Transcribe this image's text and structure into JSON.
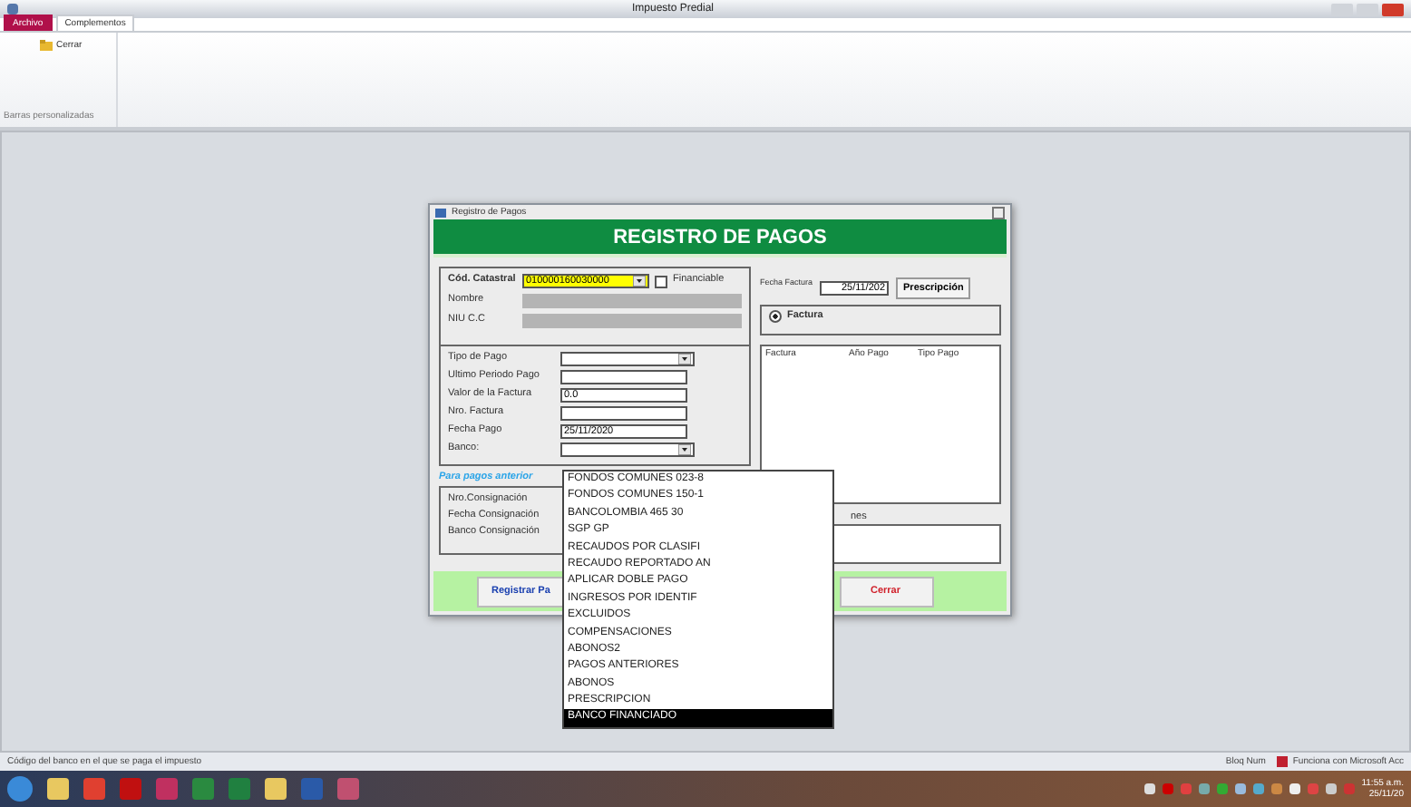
{
  "window": {
    "title": "Impuesto Predial"
  },
  "ribbon": {
    "tabs": [
      {
        "label": "Archivo",
        "kind": "file",
        "selected": false
      },
      {
        "label": "Complementos",
        "kind": "tab",
        "selected": true
      }
    ],
    "button": "Cerrar",
    "group_label": "Barras personalizadas"
  },
  "dialog": {
    "title": "Registro de Pagos",
    "header": "REGISTRO DE PAGOS",
    "catastral": {
      "label": "Cód. Catastral",
      "value": "010000160030000",
      "financiable": {
        "label": "Financiable",
        "checked": false
      }
    },
    "owner_fields": [
      "Nombre",
      "NIU C.C"
    ],
    "fecha_factura": {
      "label": "Fecha Factura",
      "value": "25/11/202"
    },
    "prescripcion_button": "Prescripción",
    "radio": {
      "label": "Factura",
      "selected": true
    },
    "fields": [
      {
        "label": "Tipo de Pago",
        "kind": "combo"
      },
      {
        "label": "Ultimo Periodo Pago",
        "kind": "text"
      },
      {
        "label": "Valor de la Factura",
        "kind": "text",
        "value": "0.0"
      },
      {
        "label": "Nro. Factura",
        "kind": "text"
      },
      {
        "label": "Fecha Pago",
        "kind": "text",
        "value": "25/11/2020"
      },
      {
        "label": "Banco:",
        "kind": "combo"
      }
    ],
    "list_columns": [
      "Factura",
      "Año Pago",
      "Tipo Pago"
    ],
    "note": "Para pagos anterior",
    "consignacion": [
      "Nro.Consignación",
      "Fecha Consignación",
      "Banco Consignación"
    ],
    "observaciones_label": "nes",
    "buttons": [
      {
        "label": "Registrar Pa",
        "kind": "primary"
      },
      {
        "label": "Cerrar",
        "kind": "danger"
      }
    ]
  },
  "dropdown": {
    "items": [
      {
        "label": "FONDOS COMUNES 023-8",
        "selected": false
      },
      {
        "label": "FONDOS COMUNES 150-1",
        "selected": false
      },
      {
        "label": "BANCOLOMBIA 465 30",
        "selected": false
      },
      {
        "label": "SGP GP",
        "selected": false
      },
      {
        "label": "RECAUDOS POR CLASIFI",
        "selected": false
      },
      {
        "label": "RECAUDO REPORTADO AN",
        "selected": false
      },
      {
        "label": "APLICAR DOBLE PAGO",
        "selected": false
      },
      {
        "label": "INGRESOS POR IDENTIF",
        "selected": false
      },
      {
        "label": "EXCLUIDOS",
        "selected": false
      },
      {
        "label": "COMPENSACIONES",
        "selected": false
      },
      {
        "label": "ABONOS2",
        "selected": false
      },
      {
        "label": "PAGOS ANTERIORES",
        "selected": false
      },
      {
        "label": "ABONOS",
        "selected": false
      },
      {
        "label": "PRESCRIPCION",
        "selected": false
      },
      {
        "label": "BANCO FINANCIADO",
        "selected": true
      }
    ]
  },
  "status_bar": {
    "hint": "Código del banco en el que se paga el impuesto",
    "num_lock": "Bloq Num",
    "app": "Funciona con Microsoft Acc"
  },
  "taskbar": {
    "time": "11:55 a.m.",
    "date": "25/11/20"
  }
}
